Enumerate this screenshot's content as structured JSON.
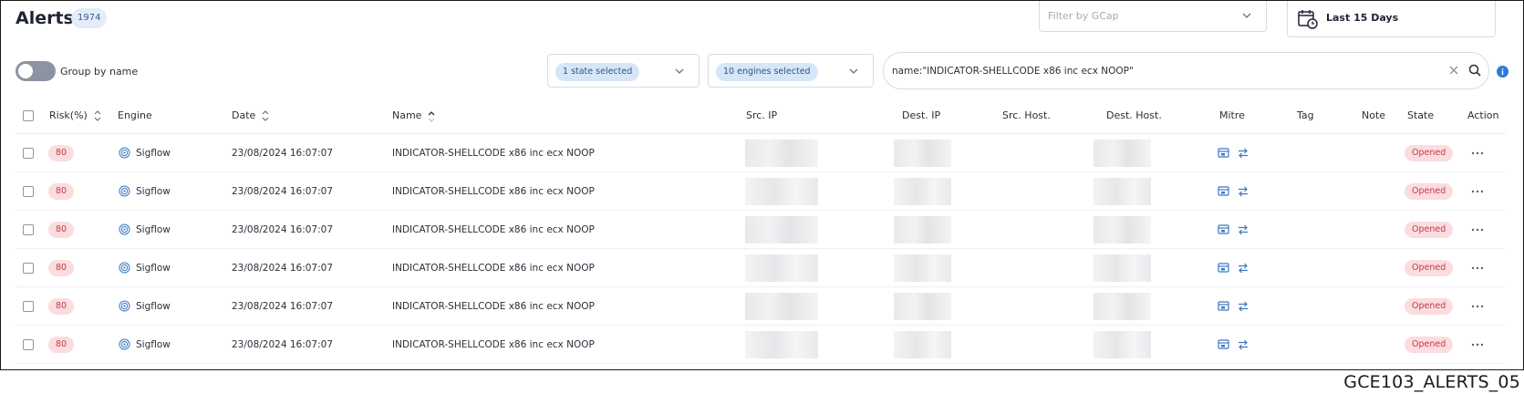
{
  "header": {
    "title": "Alerts",
    "count": "1974",
    "gcap_placeholder": "Filter by GCap",
    "date_range": "Last 15 Days"
  },
  "toolbar": {
    "group_label": "Group by name",
    "group_enabled": false,
    "state_chip": "1 state selected",
    "engine_chip": "10 engines selected",
    "search_value": "name:\"INDICATOR-SHELLCODE x86 inc ecx NOOP\""
  },
  "table": {
    "columns": {
      "risk": "Risk(%)",
      "engine": "Engine",
      "date": "Date",
      "name": "Name",
      "src_ip": "Src. IP",
      "dest_ip": "Dest. IP",
      "src_host": "Src. Host.",
      "dest_host": "Dest. Host.",
      "mitre": "Mitre",
      "tag": "Tag",
      "note": "Note",
      "state": "State",
      "action": "Action"
    },
    "rows": [
      {
        "risk": "80",
        "engine": "Sigflow",
        "date": "23/08/2024 16:07:07",
        "name": "INDICATOR-SHELLCODE x86 inc ecx NOOP",
        "state": "Opened"
      },
      {
        "risk": "80",
        "engine": "Sigflow",
        "date": "23/08/2024 16:07:07",
        "name": "INDICATOR-SHELLCODE x86 inc ecx NOOP",
        "state": "Opened"
      },
      {
        "risk": "80",
        "engine": "Sigflow",
        "date": "23/08/2024 16:07:07",
        "name": "INDICATOR-SHELLCODE x86 inc ecx NOOP",
        "state": "Opened"
      },
      {
        "risk": "80",
        "engine": "Sigflow",
        "date": "23/08/2024 16:07:07",
        "name": "INDICATOR-SHELLCODE x86 inc ecx NOOP",
        "state": "Opened"
      },
      {
        "risk": "80",
        "engine": "Sigflow",
        "date": "23/08/2024 16:07:07",
        "name": "INDICATOR-SHELLCODE x86 inc ecx NOOP",
        "state": "Opened"
      },
      {
        "risk": "80",
        "engine": "Sigflow",
        "date": "23/08/2024 16:07:07",
        "name": "INDICATOR-SHELLCODE x86 inc ecx NOOP",
        "state": "Opened"
      }
    ]
  },
  "caption": "GCE103_ALERTS_05",
  "colors": {
    "accent": "#3b78c4",
    "badge_red_bg": "#fbdcdf",
    "badge_red_text": "#c23b48",
    "chip_bg": "#d6e6f7"
  }
}
